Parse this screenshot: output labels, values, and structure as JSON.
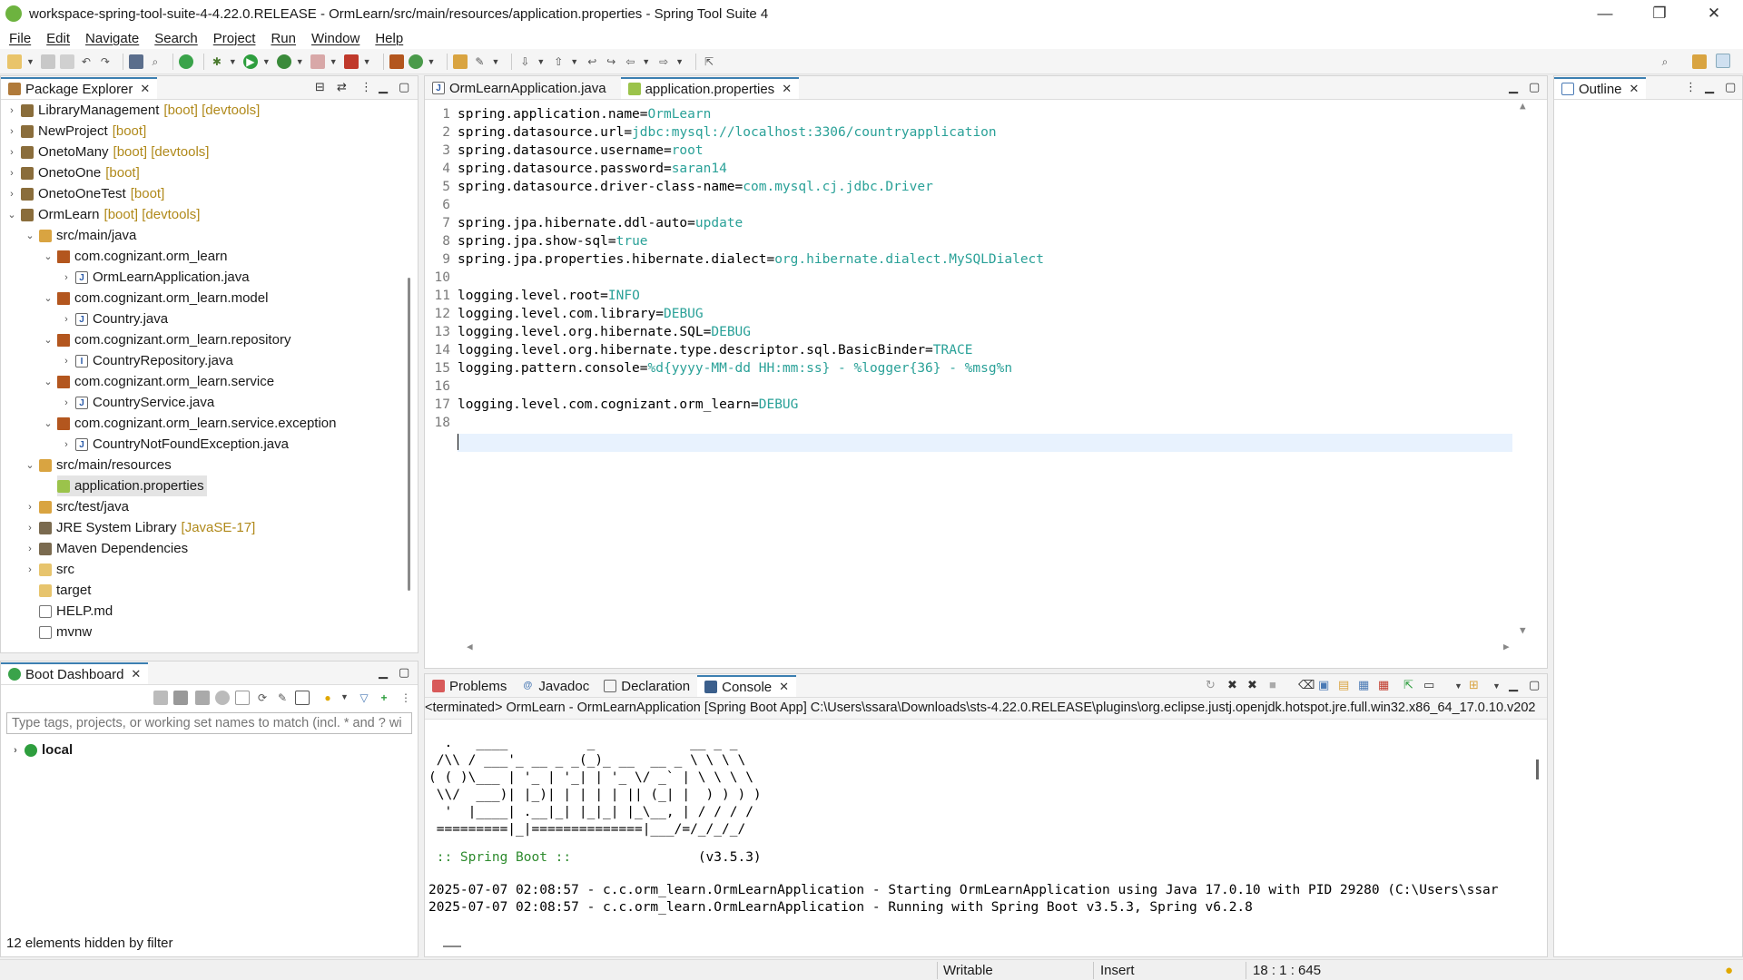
{
  "window": {
    "title": "workspace-spring-tool-suite-4-4.22.0.RELEASE - OrmLearn/src/main/resources/application.properties - Spring Tool Suite 4"
  },
  "menu": [
    "File",
    "Edit",
    "Navigate",
    "Search",
    "Project",
    "Run",
    "Window",
    "Help"
  ],
  "package_explorer": {
    "tab_label": "Package Explorer",
    "items": [
      {
        "label": "LibraryManagement",
        "deco": "[boot] [devtools]"
      },
      {
        "label": "NewProject",
        "deco": "[boot]"
      },
      {
        "label": "OnetoMany",
        "deco": "[boot] [devtools]"
      },
      {
        "label": "OnetoOne",
        "deco": "[boot]"
      },
      {
        "label": "OnetoOneTest",
        "deco": "[boot]"
      },
      {
        "label": "OrmLearn",
        "deco": "[boot] [devtools]"
      },
      {
        "label": "src/main/java",
        "deco": ""
      },
      {
        "label": "com.cognizant.orm_learn",
        "deco": ""
      },
      {
        "label": "OrmLearnApplication.java",
        "deco": ""
      },
      {
        "label": "com.cognizant.orm_learn.model",
        "deco": ""
      },
      {
        "label": "Country.java",
        "deco": ""
      },
      {
        "label": "com.cognizant.orm_learn.repository",
        "deco": ""
      },
      {
        "label": "CountryRepository.java",
        "deco": ""
      },
      {
        "label": "com.cognizant.orm_learn.service",
        "deco": ""
      },
      {
        "label": "CountryService.java",
        "deco": ""
      },
      {
        "label": "com.cognizant.orm_learn.service.exception",
        "deco": ""
      },
      {
        "label": "CountryNotFoundException.java",
        "deco": ""
      },
      {
        "label": "src/main/resources",
        "deco": ""
      },
      {
        "label": "application.properties",
        "deco": ""
      },
      {
        "label": "src/test/java",
        "deco": ""
      },
      {
        "label": "JRE System Library",
        "deco": "[JavaSE-17]"
      },
      {
        "label": "Maven Dependencies",
        "deco": ""
      },
      {
        "label": "src",
        "deco": ""
      },
      {
        "label": "target",
        "deco": ""
      },
      {
        "label": "HELP.md",
        "deco": ""
      },
      {
        "label": "mvnw",
        "deco": ""
      }
    ]
  },
  "boot_dashboard": {
    "tab_label": "Boot Dashboard",
    "filter_placeholder": "Type tags, projects, or working set names to match (incl. * and ? wi",
    "local_label": "local",
    "status": "12 elements hidden by filter"
  },
  "editor": {
    "tabs": [
      "OrmLearnApplication.java",
      "application.properties"
    ],
    "lines": [
      {
        "n": "1",
        "key": "spring.application.name=",
        "val": "OrmLearn"
      },
      {
        "n": "2",
        "key": "spring.datasource.url=",
        "val": "jdbc:mysql://localhost:3306/countryapplication"
      },
      {
        "n": "3",
        "key": "spring.datasource.username=",
        "val": "root"
      },
      {
        "n": "4",
        "key": "spring.datasource.password=",
        "val": "saran14"
      },
      {
        "n": "5",
        "key": "spring.datasource.driver-class-name=",
        "val": "com.mysql.cj.jdbc.Driver"
      },
      {
        "n": "6",
        "key": "",
        "val": ""
      },
      {
        "n": "7",
        "key": "spring.jpa.hibernate.ddl-auto=",
        "val": "update"
      },
      {
        "n": "8",
        "key": "spring.jpa.show-sql=",
        "val": "true"
      },
      {
        "n": "9",
        "key": "spring.jpa.properties.hibernate.dialect=",
        "val": "org.hibernate.dialect.MySQLDialect"
      },
      {
        "n": "10",
        "key": "",
        "val": ""
      },
      {
        "n": "11",
        "key": "logging.level.root=",
        "val": "INFO"
      },
      {
        "n": "12",
        "key": "logging.level.com.library=",
        "val": "DEBUG"
      },
      {
        "n": "13",
        "key": "logging.level.org.hibernate.SQL=",
        "val": "DEBUG"
      },
      {
        "n": "14",
        "key": "logging.level.org.hibernate.type.descriptor.sql.BasicBinder=",
        "val": "TRACE"
      },
      {
        "n": "15",
        "key": "logging.pattern.console=",
        "val": "%d{yyyy-MM-dd HH:mm:ss} - %logger{36} - %msg%n"
      },
      {
        "n": "16",
        "key": "",
        "val": ""
      },
      {
        "n": "17",
        "key": "logging.level.com.cognizant.orm_learn=",
        "val": "DEBUG"
      },
      {
        "n": "18",
        "key": "",
        "val": ""
      }
    ]
  },
  "outline": {
    "tab_label": "Outline"
  },
  "console": {
    "tabs": [
      "Problems",
      "Javadoc",
      "Declaration",
      "Console"
    ],
    "header": "<terminated> OrmLearn - OrmLearnApplication [Spring Boot App] C:\\Users\\ssara\\Downloads\\sts-4.22.0.RELEASE\\plugins\\org.eclipse.justj.openjdk.hotspot.jre.full.win32.x86_64_17.0.10.v202",
    "banner": [
      "  .   ____          _            __ _ _",
      " /\\\\ / ___'_ __ _ _(_)_ __  __ _ \\ \\ \\ \\",
      "( ( )\\___ | '_ | '_| | '_ \\/ _` | \\ \\ \\ \\",
      " \\\\/  ___)| |_)| | | | | || (_| |  ) ) ) )",
      "  '  |____| .__|_| |_|_| |_\\__, | / / / /",
      " =========|_|==============|___/=/_/_/_/"
    ],
    "spring_boot_label": " :: Spring Boot :: ",
    "spring_boot_version": "               (v3.5.3)",
    "log": [
      "2025-07-07 02:08:57 - c.c.orm_learn.OrmLearnApplication - Starting OrmLearnApplication using Java 17.0.10 with PID 29280 (C:\\Users\\ssar",
      "2025-07-07 02:08:57 - c.c.orm_learn.OrmLearnApplication - Running with Spring Boot v3.5.3, Spring v6.2.8"
    ]
  },
  "status": {
    "writable": "Writable",
    "insert": "Insert",
    "position": "18 : 1 : 645"
  }
}
